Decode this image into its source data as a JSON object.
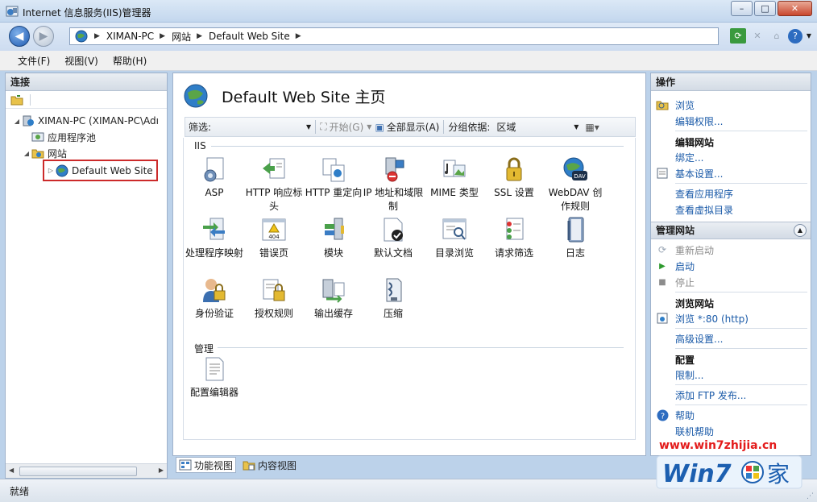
{
  "window": {
    "title": "Internet 信息服务(IIS)管理器",
    "buttons": {
      "minimize": "–",
      "maximize": "□",
      "close": "✕"
    }
  },
  "address": {
    "crumbs": [
      "XIMAN-PC",
      "网站",
      "Default Web Site"
    ]
  },
  "menubar": {
    "items": [
      "文件(F)",
      "视图(V)",
      "帮助(H)"
    ]
  },
  "connections": {
    "header": "连接",
    "tree": {
      "server": "XIMAN-PC (XIMAN-PC\\Adı",
      "app_pools": "应用程序池",
      "sites": "网站",
      "selected_site": "Default Web Site"
    }
  },
  "center": {
    "title": "Default Web Site 主页",
    "filter": {
      "label": "筛选:",
      "start": "开始(G)",
      "show_all": "全部显示(A)",
      "group_by_label": "分组依据:",
      "group_by_value": "区域"
    },
    "groups": {
      "iis": "IIS",
      "manage": "管理"
    },
    "iis_features_row1": [
      "ASP",
      "HTTP 响应标头",
      "HTTP 重定向",
      "IP 地址和域限制",
      "MIME 类型",
      "SSL 设置",
      "WebDAV 创作规则"
    ],
    "iis_features_row2": [
      "处理程序映射",
      "错误页",
      "模块",
      "默认文档",
      "目录浏览",
      "请求筛选",
      "日志"
    ],
    "iis_features_row3": [
      "身份验证",
      "授权规则",
      "输出缓存",
      "压缩"
    ],
    "manage_features": [
      "配置编辑器"
    ],
    "error_page_icon_text": "404"
  },
  "view_tabs": {
    "features": "功能视图",
    "content": "内容视图"
  },
  "actions": {
    "header": "操作",
    "explore": "浏览",
    "edit_permissions": "编辑权限...",
    "edit_site_head": "编辑网站",
    "bindings": "绑定...",
    "basic_settings": "基本设置...",
    "view_apps": "查看应用程序",
    "view_vdirs": "查看虚拟目录",
    "manage_site_head": "管理网站",
    "restart": "重新启动",
    "start": "启动",
    "stop": "停止",
    "browse_site_head": "浏览网站",
    "browse_80": "浏览 *:80 (http)",
    "advanced_settings": "高级设置...",
    "config_head": "配置",
    "limits": "限制...",
    "add_ftp": "添加 FTP 发布...",
    "help": "帮助",
    "online_help": "联机帮助"
  },
  "status": {
    "text": "就绪"
  },
  "watermark": {
    "url": "www.win7zhijia.cn",
    "logo_text": "Win7",
    "logo_suffix": "家"
  },
  "colors": {
    "link": "#1a5aa8",
    "selection_border": "#cc2a2a",
    "watermark_red": "#e31b1b"
  }
}
